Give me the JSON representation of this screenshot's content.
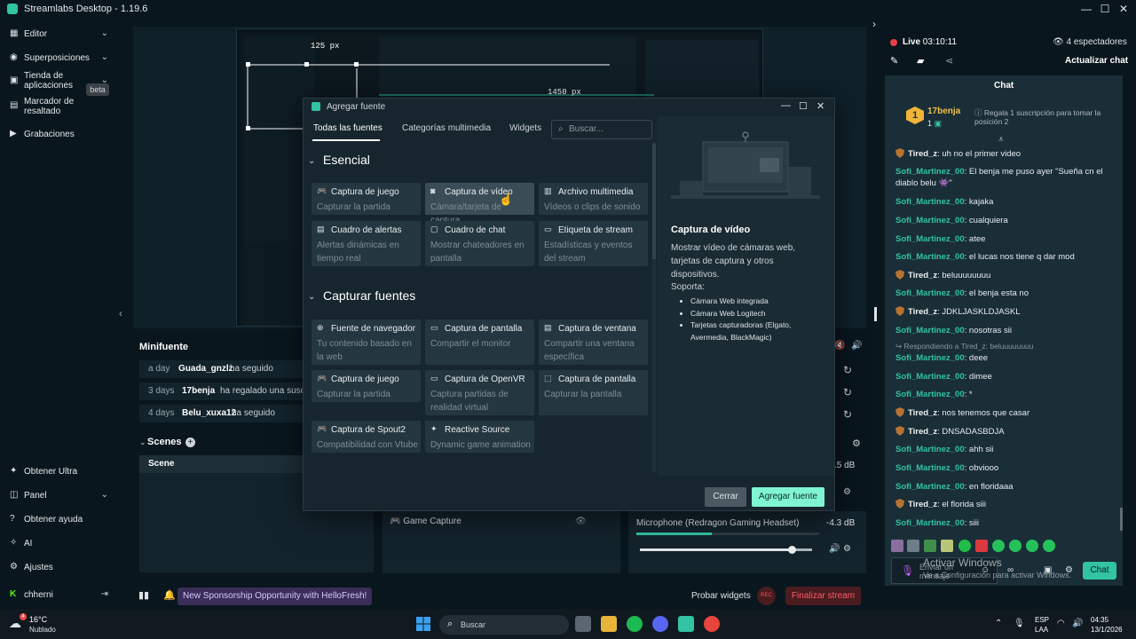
{
  "app": {
    "title": "Streamlabs Desktop - 1.19.6"
  },
  "sidebar": {
    "items": [
      {
        "label": "Editor"
      },
      {
        "label": "Superposiciones"
      },
      {
        "label": "Tienda de aplicaciones"
      },
      {
        "label": "Marcador de resaltado",
        "badge": "beta"
      },
      {
        "label": "Grabaciones"
      }
    ],
    "bottom": [
      {
        "label": "Obtener Ultra"
      },
      {
        "label": "Panel"
      },
      {
        "label": "Obtener ayuda"
      },
      {
        "label": "AI"
      },
      {
        "label": "Ajustes"
      },
      {
        "label": "chherni"
      }
    ]
  },
  "preview": {
    "label_125": "125 px",
    "label_1450": "1450 px"
  },
  "activity": {
    "title": "Minifuente",
    "rows": [
      {
        "time": "a day",
        "name": "Guada_gnzlz",
        "action": "ha seguido"
      },
      {
        "time": "3 days",
        "name": "17benja",
        "action": "ha regalado una suscrip"
      },
      {
        "time": "4 days",
        "name": "Belu_xuxa12",
        "action": "ha seguido"
      }
    ]
  },
  "scenes": {
    "title": "Scenes",
    "column": "Scene"
  },
  "sources": {
    "item": "Game Capture"
  },
  "mixer": {
    "label": "Microphone (Redragon Gaming Headset)",
    "db": "-4.3 dB",
    "db_top": ".5 dB",
    "level": 0.41,
    "volume": 0.88
  },
  "footer": {
    "sponsor": "New Sponsorship Opportunity with HelloFresh!",
    "test_widgets": "Probar widgets",
    "rec": "REC",
    "end_stream": "Finalizar stream"
  },
  "stream": {
    "live": "Live",
    "time": "03:10:11",
    "viewers": "4 espectadores",
    "refresh_chat": "Actualizar chat"
  },
  "chat": {
    "title": "Chat",
    "pinned": {
      "level": "1",
      "name": "17benja",
      "count": "1",
      "message": "Regala 1 suscripción para tomar la posición 2"
    },
    "reply_note": "Respondiendo a Tired_z: beluuuuuuuu",
    "messages": [
      {
        "user": "Tired_z",
        "text": "uh no el primer video",
        "badge": true
      },
      {
        "user": "Sofi_Martinez_00",
        "text": "El benja me puso ayer \"Sueña cn el diablo belu 👾\"",
        "badge": false
      },
      {
        "user": "Sofi_Martinez_00",
        "text": "kajaka",
        "badge": false
      },
      {
        "user": "Sofi_Martinez_00",
        "text": "cualquiera",
        "badge": false
      },
      {
        "user": "Sofi_Martinez_00",
        "text": "atee",
        "badge": false
      },
      {
        "user": "Sofi_Martinez_00",
        "text": "el lucas nos tiene q dar mod",
        "badge": false
      },
      {
        "user": "Tired_z",
        "text": "beluuuuuuuu",
        "badge": true
      },
      {
        "user": "Sofi_Martinez_00",
        "text": "el benja esta no",
        "badge": false
      },
      {
        "user": "Tired_z",
        "text": "JDKLJASKLDJASKL",
        "badge": true
      },
      {
        "user": "Sofi_Martinez_00",
        "text": "nosotras sii",
        "badge": false
      },
      {
        "user": "Sofi_Martinez_00",
        "text": "deee",
        "badge": false
      },
      {
        "user": "Sofi_Martinez_00",
        "text": "dimee",
        "badge": false
      },
      {
        "user": "Sofi_Martinez_00",
        "text": "*",
        "badge": false
      },
      {
        "user": "Tired_z",
        "text": "nos tenemos que casar",
        "badge": true
      },
      {
        "user": "Tired_z",
        "text": "DNSADASBDJA",
        "badge": true
      },
      {
        "user": "Sofi_Martinez_00",
        "text": "ahh sii",
        "badge": false
      },
      {
        "user": "Sofi_Martinez_00",
        "text": "obviooo",
        "badge": false
      },
      {
        "user": "Sofi_Martinez_00",
        "text": "en floridaaa",
        "badge": false
      },
      {
        "user": "Tired_z",
        "text": "el florida siii",
        "badge": true
      },
      {
        "user": "Sofi_Martinez_00",
        "text": "siii",
        "badge": false
      }
    ],
    "input_placeholder": "Enviar un mensaje",
    "send": "Chat"
  },
  "windows_watermark": {
    "title": "Activar Windows",
    "subtitle": "Ve a Configuración para activar Windows."
  },
  "dialog": {
    "title": "Agregar fuente",
    "tabs": [
      "Todas las fuentes",
      "Categorías multimedia",
      "Widgets"
    ],
    "search_placeholder": "Buscar...",
    "sections": [
      {
        "title": "Esencial",
        "cards": [
          {
            "title": "Captura de juego",
            "desc": "Capturar la partida"
          },
          {
            "title": "Captura de vídeo",
            "desc": "Cámara/tarjeta de captura"
          },
          {
            "title": "Archivo multimedia",
            "desc": "Vídeos o clips de sonido"
          },
          {
            "title": "Cuadro de alertas",
            "desc": "Alertas dinámicas en tiempo real"
          },
          {
            "title": "Cuadro de chat",
            "desc": "Mostrar chateadores en pantalla"
          },
          {
            "title": "Etiqueta de stream",
            "desc": "Estadísticas y eventos del stream"
          }
        ]
      },
      {
        "title": "Capturar fuentes",
        "cards": [
          {
            "title": "Fuente de navegador",
            "desc": "Tu contenido basado en la web"
          },
          {
            "title": "Captura de pantalla",
            "desc": "Compartir el monitor"
          },
          {
            "title": "Captura de ventana",
            "desc": "Compartir una ventana específica"
          },
          {
            "title": "Captura de juego",
            "desc": "Capturar la partida"
          },
          {
            "title": "Captura de OpenVR",
            "desc": "Captura partidas de realidad virtual"
          },
          {
            "title": "Captura de pantalla",
            "desc": "Capturar la pantalla"
          },
          {
            "title": "Captura de Spout2",
            "desc": "Compatibilidad con Vtube"
          },
          {
            "title": "Reactive Source",
            "desc": "Dynamic game animation"
          }
        ]
      }
    ],
    "info": {
      "title": "Captura de vídeo",
      "desc": "Mostrar vídeo de cámaras web, tarjetas de captura y otros dispositivos.",
      "supports": "Soporta:",
      "list": [
        "Cámara Web integrada",
        "Cámara Web Logitech",
        "Tarjetas capturadoras (Elgato, Avermedia, BlackMagic)"
      ]
    },
    "cancel": "Cerrar",
    "add": "Agregar fuente"
  },
  "taskbar": {
    "weather_temp": "16°C",
    "weather_desc": "Nublado",
    "search": "Buscar",
    "lang1": "ESP",
    "lang2": "LAA",
    "time": "04:35",
    "date": "13/1/2026"
  },
  "colors": {
    "accent": "#31c3a2",
    "live": "#e93d48",
    "dialog_add": "#80f5d2"
  }
}
